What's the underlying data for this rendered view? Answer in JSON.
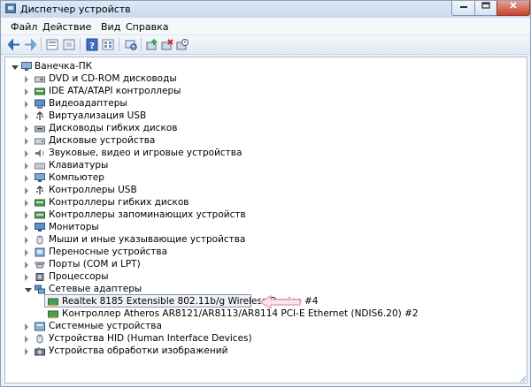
{
  "window": {
    "title": "Диспетчер устройств",
    "minimize_icon": "minimize-icon",
    "maximize_icon": "maximize-icon",
    "close_icon": "close-icon"
  },
  "menu": [
    "Файл",
    "Действие",
    "Вид",
    "Справка"
  ],
  "toolbar": [
    "back-icon",
    "forward-icon",
    "properties-icon",
    "hidden-devices-icon",
    "help-icon",
    "view-icon",
    "scan-hardware-icon",
    "update-driver-icon",
    "uninstall-icon",
    "disable-icon"
  ],
  "tree": {
    "root": "Ванечка-ПК",
    "categories": [
      {
        "label": "DVD и CD-ROM дисководы",
        "icon": "dvd-drive-icon"
      },
      {
        "label": "IDE ATA/ATAPI контроллеры",
        "icon": "ide-controller-icon"
      },
      {
        "label": "Видеоадаптеры",
        "icon": "display-adapter-icon"
      },
      {
        "label": "Виртуализация USB",
        "icon": "usb-virtualization-icon"
      },
      {
        "label": "Дисководы гибких дисков",
        "icon": "floppy-drive-icon"
      },
      {
        "label": "Дисковые устройства",
        "icon": "disk-drive-icon"
      },
      {
        "label": "Звуковые, видео и игровые устройства",
        "icon": "sound-icon"
      },
      {
        "label": "Клавиатуры",
        "icon": "keyboard-icon"
      },
      {
        "label": "Компьютер",
        "icon": "computer-icon"
      },
      {
        "label": "Контроллеры USB",
        "icon": "usb-controller-icon"
      },
      {
        "label": "Контроллеры гибких дисков",
        "icon": "floppy-controller-icon"
      },
      {
        "label": "Контроллеры запоминающих устройств",
        "icon": "storage-controller-icon"
      },
      {
        "label": "Мониторы",
        "icon": "monitor-icon"
      },
      {
        "label": "Мыши и иные указывающие устройства",
        "icon": "mouse-icon"
      },
      {
        "label": "Переносные устройства",
        "icon": "portable-device-icon"
      },
      {
        "label": "Порты (COM и LPT)",
        "icon": "port-icon"
      },
      {
        "label": "Процессоры",
        "icon": "processor-icon"
      },
      {
        "label": "Сетевые адаптеры",
        "icon": "network-adapter-icon",
        "expanded": true,
        "children": [
          {
            "label": "Realtek 8185 Extensible 802.11b/g Wireless Device #4",
            "icon": "network-card-icon",
            "selected": true
          },
          {
            "label": "Контроллер Atheros AR8121/AR8113/AR8114 PCI-E Ethernet (NDIS6.20) #2",
            "icon": "network-card-icon"
          }
        ]
      },
      {
        "label": "Системные устройства",
        "icon": "system-device-icon"
      },
      {
        "label": "Устройства HID (Human Interface Devices)",
        "icon": "hid-icon"
      },
      {
        "label": "Устройства обработки изображений",
        "icon": "imaging-device-icon"
      }
    ]
  },
  "annotation": {
    "icon": "pointing-arrow-icon",
    "color": "#e8a0c4"
  }
}
